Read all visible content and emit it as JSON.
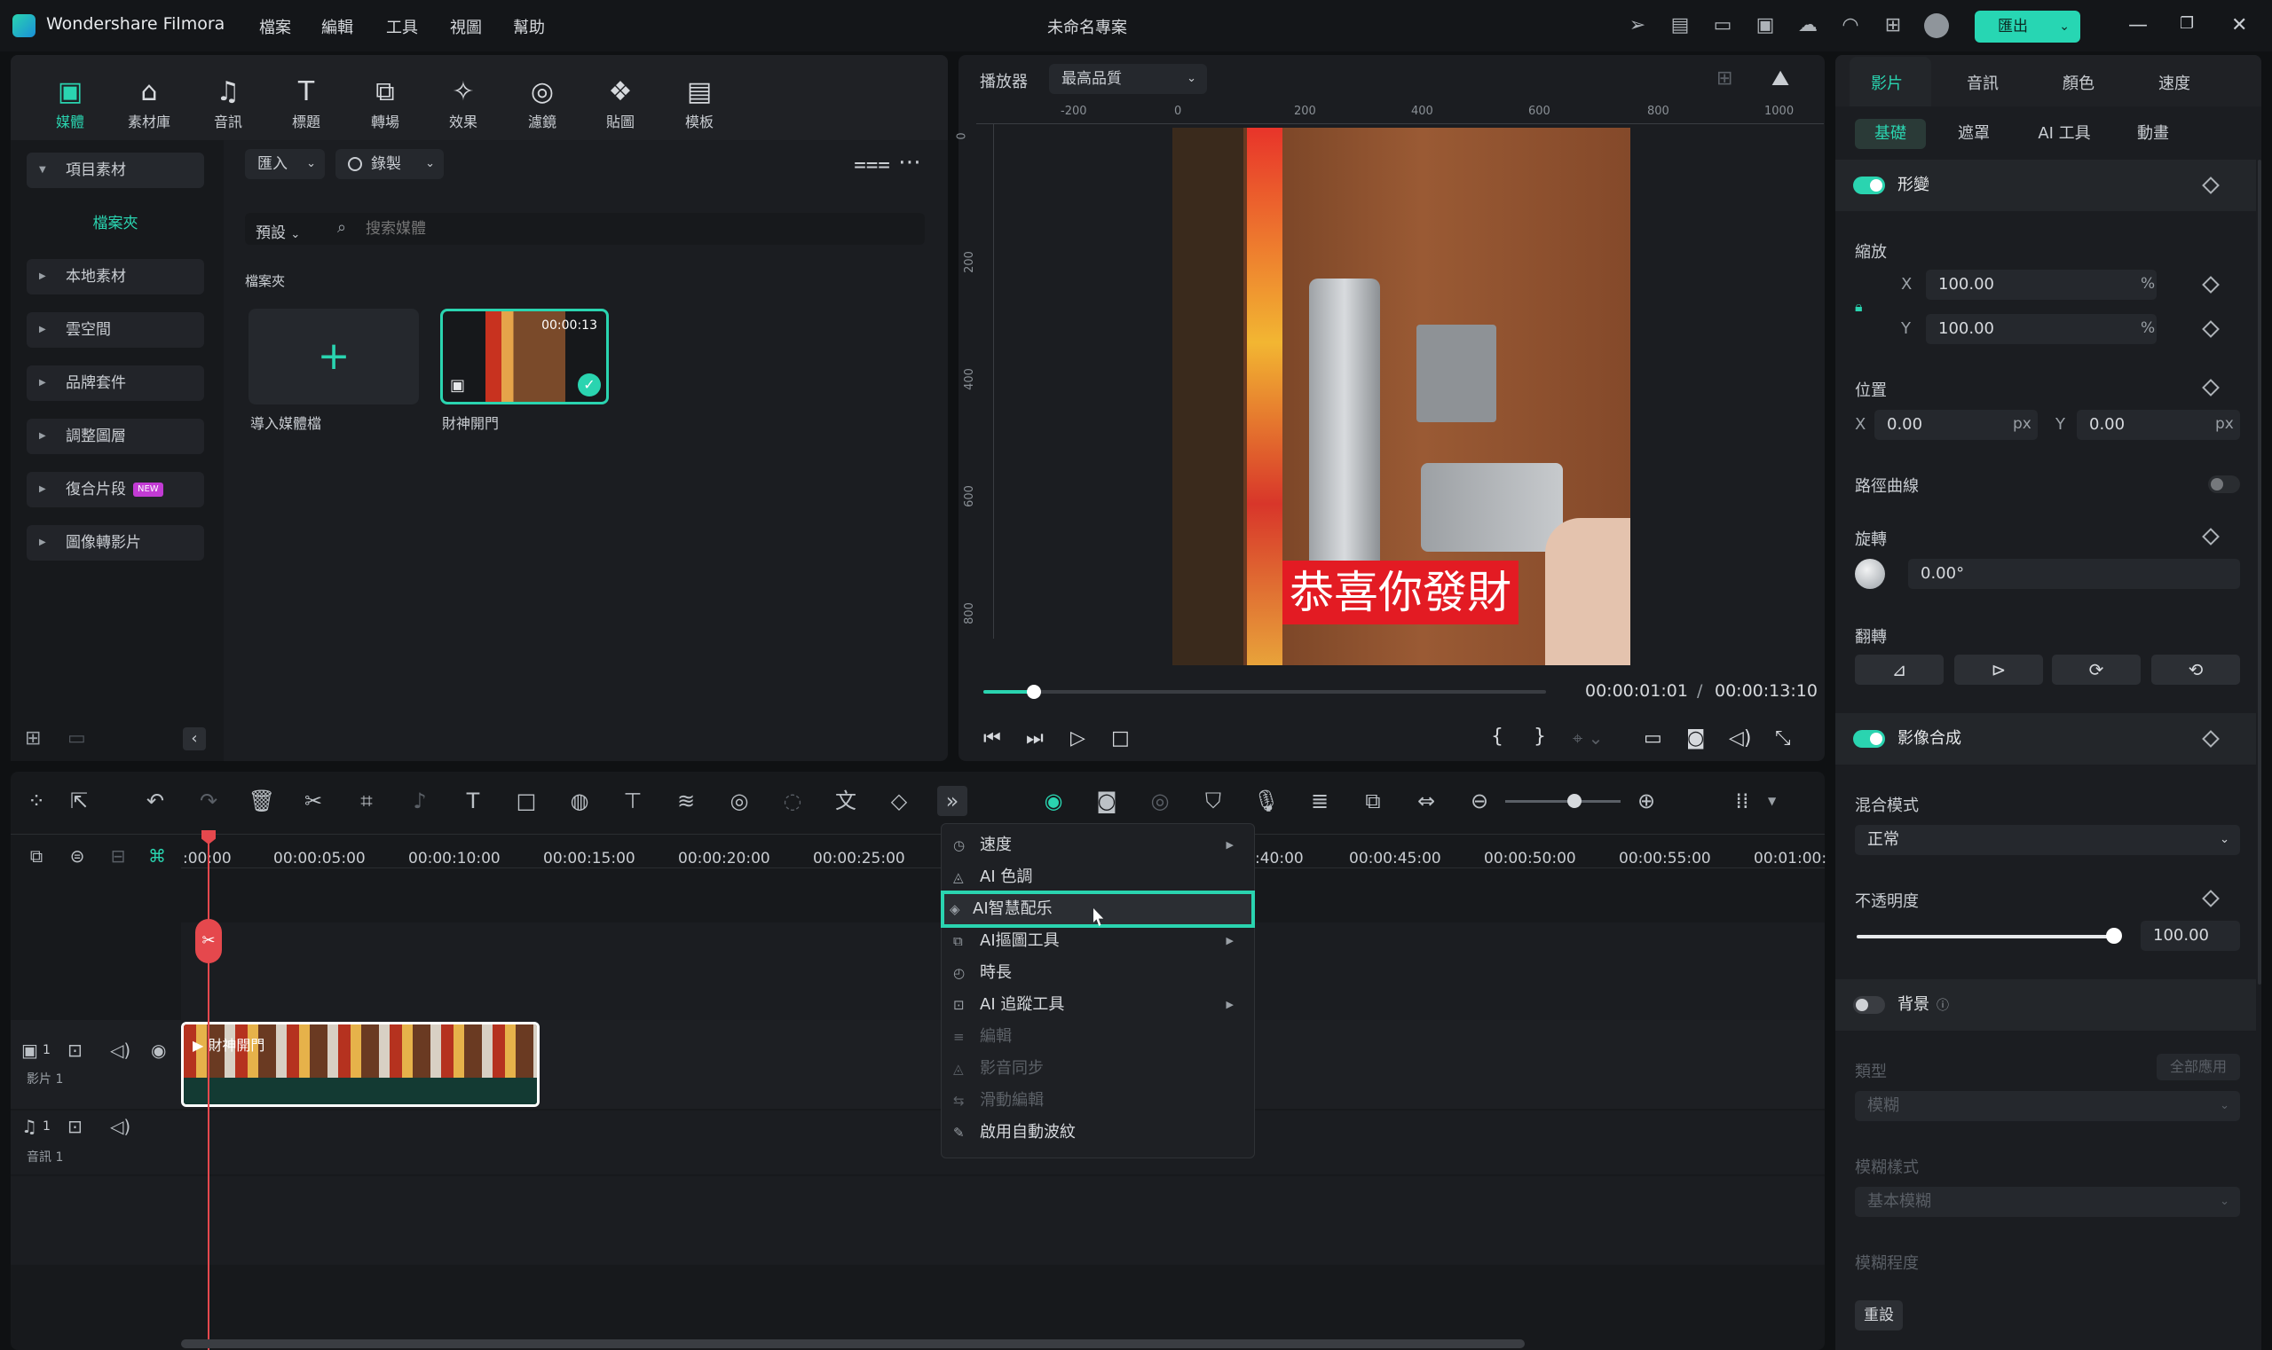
{
  "titlebar": {
    "app_name": "Wondershare Filmora",
    "menus": [
      "檔案",
      "編輯",
      "工具",
      "視圖",
      "幫助"
    ],
    "project_title": "未命名專案",
    "export_label": "匯出"
  },
  "media_panel": {
    "tabs": [
      {
        "label": "媒體",
        "icon": "▣"
      },
      {
        "label": "素材庫",
        "icon": "⌂"
      },
      {
        "label": "音訊",
        "icon": "♫"
      },
      {
        "label": "標題",
        "icon": "T"
      },
      {
        "label": "轉場",
        "icon": "⧉"
      },
      {
        "label": "效果",
        "icon": "✧"
      },
      {
        "label": "濾鏡",
        "icon": "◎"
      },
      {
        "label": "貼圖",
        "icon": "❖"
      },
      {
        "label": "模板",
        "icon": "▤"
      }
    ],
    "sidebar": {
      "project_assets": "項目素材",
      "folder": "檔案夾",
      "items": [
        "本地素材",
        "雲空間",
        "品牌套件",
        "調整圖層",
        "復合片段",
        "圖像轉影片"
      ],
      "new_badge": "NEW"
    },
    "import_label": "匯入",
    "record_label": "錄製",
    "sort_label": "預設",
    "search_placeholder": "搜索媒體",
    "folder_heading": "檔案夾",
    "cards": [
      {
        "caption": "導入媒體檔"
      },
      {
        "caption": "財神開門",
        "duration": "00:00:13"
      }
    ]
  },
  "preview": {
    "player_label": "播放器",
    "quality_label": "最高品質",
    "ruler_h": [
      "-200",
      "0",
      "200",
      "400",
      "600",
      "800",
      "1000"
    ],
    "ruler_v": [
      "0",
      "200",
      "400",
      "600",
      "800"
    ],
    "subtitle": "恭喜你發財",
    "current_time": "00:00:01:01",
    "separator": "/",
    "total_time": "00:00:13:10",
    "progress": 0.09
  },
  "properties": {
    "tabs": [
      "影片",
      "音訊",
      "顏色",
      "速度"
    ],
    "subtabs": [
      "基礎",
      "遮罩",
      "AI 工具",
      "動畫"
    ],
    "transform_label": "形變",
    "scale_label": "縮放",
    "scale_x": "100.00",
    "scale_y": "100.00",
    "x_label": "X",
    "y_label": "Y",
    "percent": "%",
    "position_label": "位置",
    "pos_x": "0.00",
    "pos_y": "0.00",
    "px": "px",
    "path_curve_label": "路徑曲線",
    "rotation_label": "旋轉",
    "rotation_value": "0.00°",
    "flip_label": "翻轉",
    "compositing_label": "影像合成",
    "blend_label": "混合模式",
    "blend_value": "正常",
    "opacity_label": "不透明度",
    "opacity_value": "100.00",
    "opacity_level": 1.0,
    "background_label": "背景",
    "type_label": "類型",
    "apply_all_label": "全部應用",
    "type_value": "模糊",
    "blur_style_label": "模糊樣式",
    "blur_style_value": "基本模糊",
    "blur_level_label": "模糊程度",
    "reset_label": "重設"
  },
  "timeline": {
    "ticks": [
      ":00:00",
      "00:00:05:00",
      "00:00:10:00",
      "00:00:15:00",
      "00:00:20:00",
      "00:00:25:00",
      ":40:00",
      "00:00:45:00",
      "00:00:50:00",
      "00:00:55:00",
      "00:01:00:"
    ],
    "video_track": {
      "index": "1",
      "name": "影片 1",
      "clip_title": "財神開門"
    },
    "audio_track": {
      "index": "1",
      "name": "音訊 1"
    },
    "zoom_level": 0.6
  },
  "context_menu": {
    "items": [
      {
        "label": "速度",
        "icon": "◷",
        "submenu": true,
        "disabled": false
      },
      {
        "label": "AI 色調",
        "icon": "◬",
        "submenu": false,
        "disabled": false
      },
      {
        "label": "AI智慧配乐",
        "icon": "◈",
        "submenu": false,
        "disabled": false,
        "highlighted": true
      },
      {
        "label": "AI摳圖工具",
        "icon": "⧉",
        "submenu": true,
        "disabled": false
      },
      {
        "label": "時長",
        "icon": "◴",
        "submenu": false,
        "disabled": false
      },
      {
        "label": "AI 追蹤工具",
        "icon": "⊡",
        "submenu": true,
        "disabled": false
      },
      {
        "label": "編輯",
        "icon": "≡",
        "submenu": false,
        "disabled": true
      },
      {
        "label": "影音同步",
        "icon": "◬",
        "submenu": false,
        "disabled": true
      },
      {
        "label": "滑動編輯",
        "icon": "⇆",
        "submenu": false,
        "disabled": true
      },
      {
        "label": "啟用自動波紋",
        "icon": "✎",
        "submenu": false,
        "disabled": false
      }
    ]
  },
  "colors": {
    "accent": "#2ad4b0",
    "playhead": "#e5484d",
    "background": "#0f1113",
    "panel": "#1b1d21"
  }
}
